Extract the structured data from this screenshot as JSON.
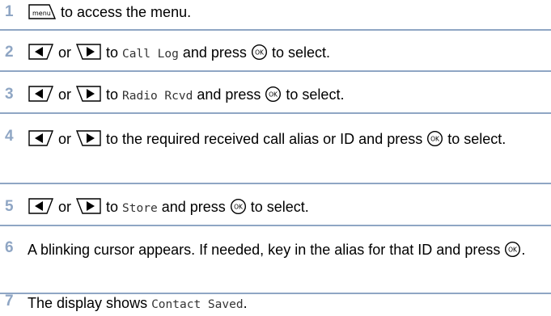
{
  "steps": [
    {
      "number": "1",
      "parts": [
        {
          "icon": "menu-key-icon",
          "label": "menu"
        },
        {
          "text": " to access the menu."
        }
      ]
    },
    {
      "number": "2",
      "parts": [
        {
          "icon": "left-arrow-key-icon"
        },
        {
          "text": " or "
        },
        {
          "icon": "right-arrow-key-icon"
        },
        {
          "text": " to "
        },
        {
          "mono": "Call Log"
        },
        {
          "text": " and press "
        },
        {
          "icon": "ok-key-icon",
          "label": "OK"
        },
        {
          "text": " to select."
        }
      ]
    },
    {
      "number": "3",
      "parts": [
        {
          "icon": "left-arrow-key-icon"
        },
        {
          "text": " or "
        },
        {
          "icon": "right-arrow-key-icon"
        },
        {
          "text": " to "
        },
        {
          "mono": "Radio Rcvd"
        },
        {
          "text": " and press "
        },
        {
          "icon": "ok-key-icon",
          "label": "OK"
        },
        {
          "text": " to select."
        }
      ]
    },
    {
      "number": "4",
      "parts": [
        {
          "icon": "left-arrow-key-icon"
        },
        {
          "text": " or "
        },
        {
          "icon": "right-arrow-key-icon"
        },
        {
          "text": " to the required received call alias or ID and press "
        },
        {
          "icon": "ok-key-icon",
          "label": "OK"
        },
        {
          "text": " to select."
        }
      ]
    },
    {
      "number": "5",
      "parts": [
        {
          "icon": "left-arrow-key-icon"
        },
        {
          "text": " or "
        },
        {
          "icon": "right-arrow-key-icon"
        },
        {
          "text": " to "
        },
        {
          "mono": "Store"
        },
        {
          "text": " and press "
        },
        {
          "icon": "ok-key-icon",
          "label": "OK"
        },
        {
          "text": " to select."
        }
      ]
    },
    {
      "number": "6",
      "parts": [
        {
          "text": "A blinking cursor appears. If needed, key in the alias for that ID and press "
        },
        {
          "icon": "ok-key-icon",
          "label": "OK"
        },
        {
          "text": "."
        }
      ]
    },
    {
      "number": "7",
      "parts": [
        {
          "text": "The display shows "
        },
        {
          "mono": "Contact Saved"
        },
        {
          "text": "."
        }
      ]
    }
  ],
  "colors": {
    "step_number": "#8fa6c4",
    "separator": "#8fa6c4"
  }
}
